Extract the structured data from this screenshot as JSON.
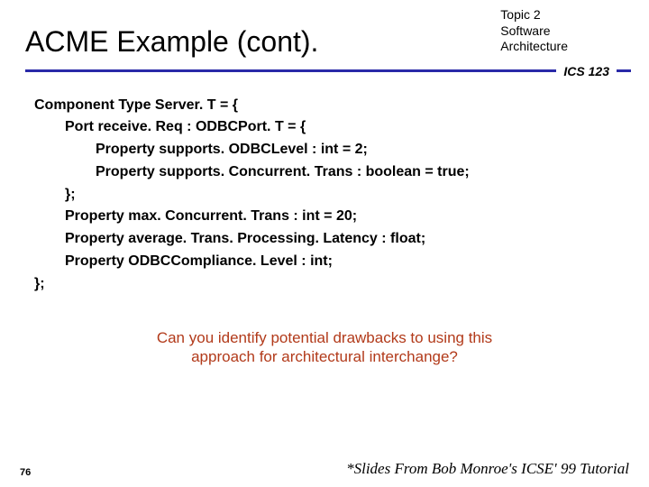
{
  "header": {
    "title": "ACME Example (cont).",
    "topic_line1": "Topic 2",
    "topic_line2": "Software",
    "topic_line3": "Architecture",
    "course": "ICS 123"
  },
  "code": {
    "l0": "Component Type Server. T = {",
    "l1": "Port receive. Req : ODBCPort. T = {",
    "l2": "Property supports. ODBCLevel : int = 2;",
    "l3": "Property supports. Concurrent. Trans : boolean = true;",
    "l4": "};",
    "l5": "Property max. Concurrent. Trans : int = 20;",
    "l6": "Property average. Trans. Processing. Latency : float;",
    "l7": "Property ODBCCompliance. Level : int;",
    "l8": "};"
  },
  "question": "Can you identify potential drawbacks to using this approach for architectural interchange?",
  "footer": {
    "page": "76",
    "credit": "*Slides From Bob Monroe's ICSE' 99 Tutorial"
  }
}
